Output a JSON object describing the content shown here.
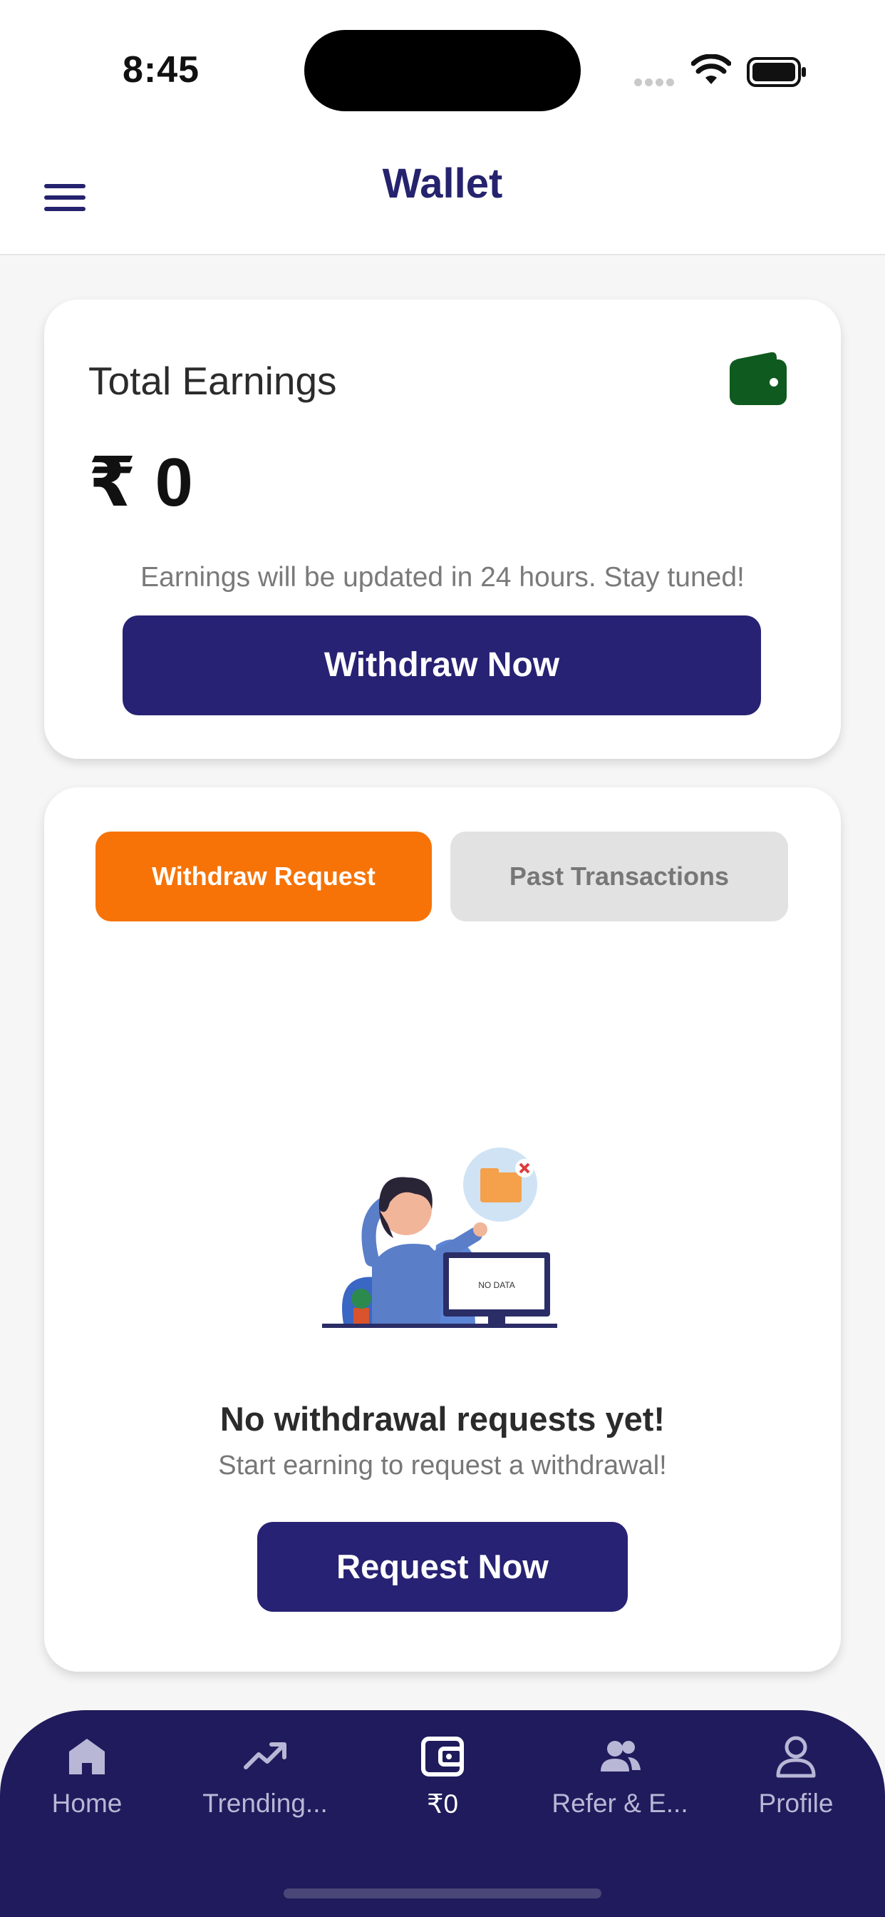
{
  "status_bar": {
    "time": "8:45"
  },
  "header": {
    "title": "Wallet",
    "menu_icon": "hamburger-menu-icon"
  },
  "earnings": {
    "title": "Total Earnings",
    "amount": "₹ 0",
    "note": "Earnings will be updated in 24 hours. Stay tuned!",
    "withdraw_label": "Withdraw Now",
    "icon": "wallet-icon",
    "icon_color": "#0f5a1e"
  },
  "requests": {
    "tabs": [
      {
        "label": "Withdraw Request",
        "active": true
      },
      {
        "label": "Past Transactions",
        "active": false
      }
    ],
    "illustration_text": "NO DATA",
    "empty_title": "No withdrawal requests yet!",
    "empty_subtitle": "Start earning to request a withdrawal!",
    "request_label": "Request Now"
  },
  "bottom_nav": {
    "items": [
      {
        "label": "Home",
        "icon": "home-icon"
      },
      {
        "label": "Trending...",
        "icon": "trending-icon"
      },
      {
        "label": "₹0",
        "icon": "wallet-icon",
        "active": true
      },
      {
        "label": "Refer & E...",
        "icon": "people-icon"
      },
      {
        "label": "Profile",
        "icon": "profile-icon"
      }
    ]
  },
  "colors": {
    "primary": "#272273",
    "accent": "#f77307",
    "nav_background": "#1f1b5c"
  }
}
